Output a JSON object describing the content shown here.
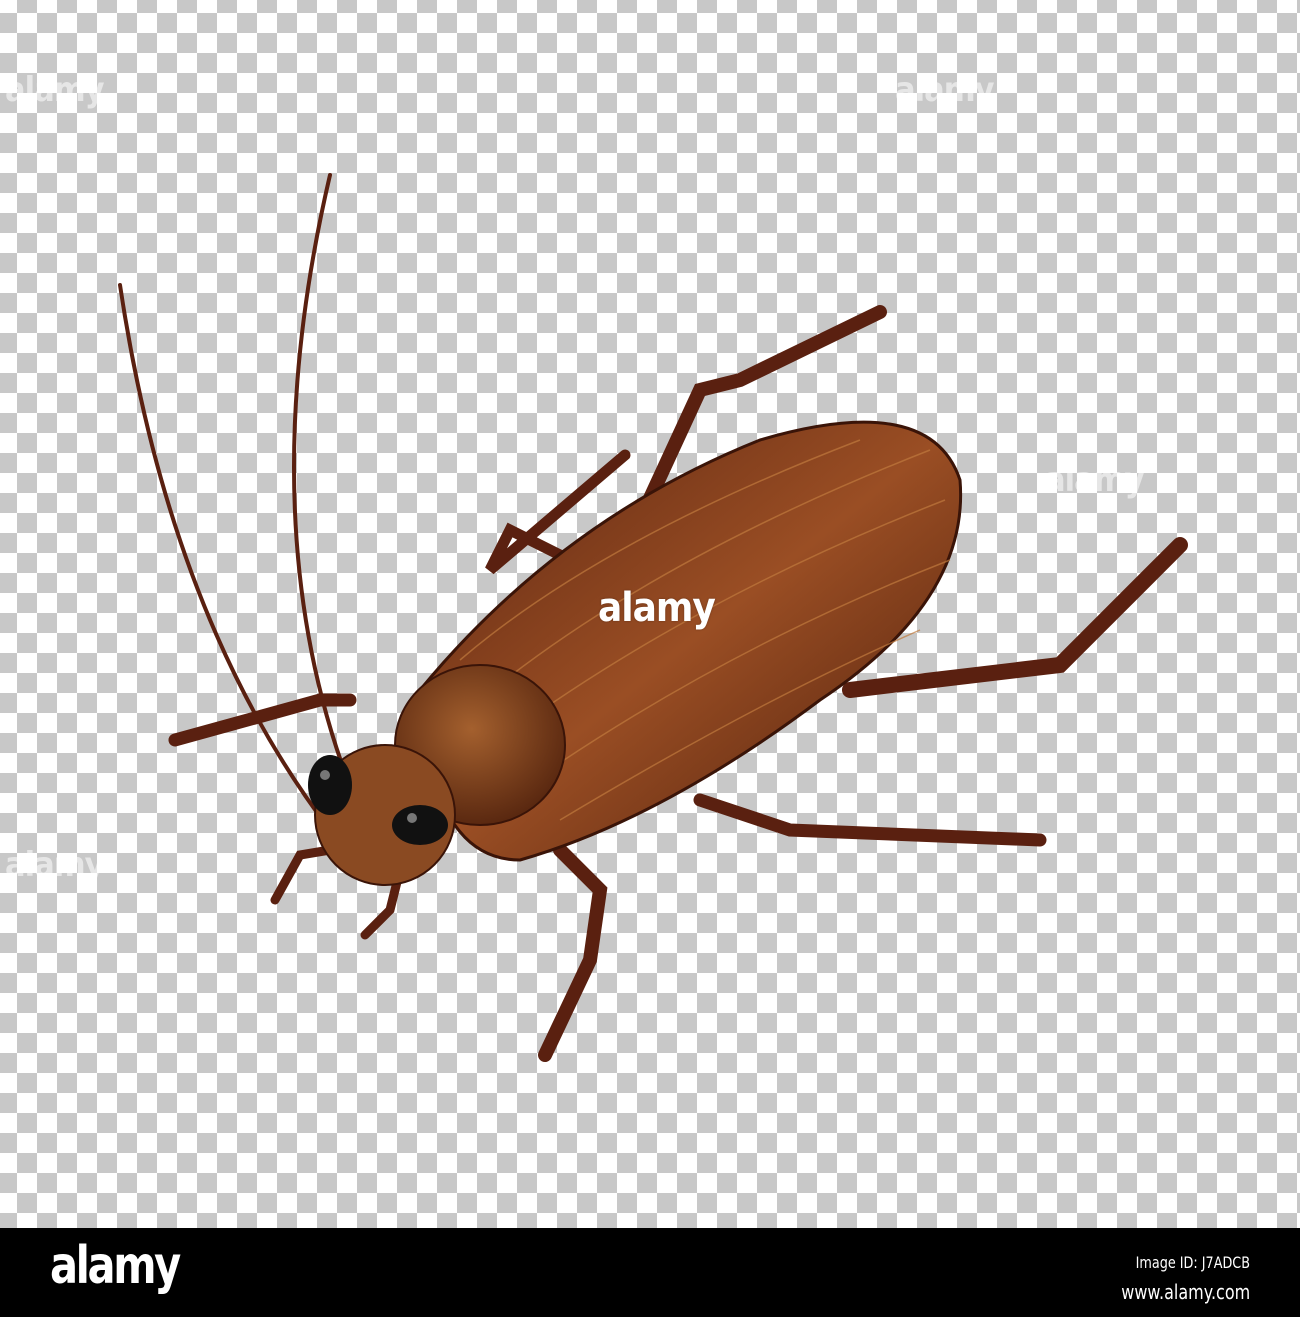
{
  "image": {
    "subject": "cockroach illustration",
    "colors": {
      "body": "#6b2e14",
      "highlight": "#a0552a",
      "dark": "#3a1408"
    }
  },
  "watermark": {
    "text": "alamy"
  },
  "footer": {
    "logo": "alamy",
    "image_id": "Image ID: J7ADCB",
    "url": "www.alamy.com"
  }
}
